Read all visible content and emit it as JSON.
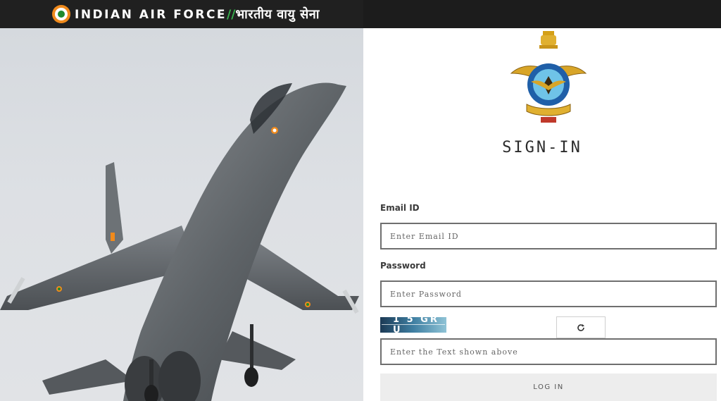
{
  "header": {
    "brand_english": "INDIAN AIR FORCE",
    "brand_separator": "//",
    "brand_hindi": "भारतीय वायु सेना",
    "colors": {
      "bar": "#1c1c1c",
      "separator": "#37b24d",
      "roundel_outer": "#f08a1c",
      "roundel_inner": "#1f8a2c"
    }
  },
  "hero": {
    "image": "fighter-jet-photo"
  },
  "signin": {
    "emblem": "iaf-crest-icon",
    "title": "SIGN-IN",
    "email": {
      "label": "Email ID",
      "placeholder": "Enter Email ID",
      "value": ""
    },
    "password": {
      "label": "Password",
      "placeholder": "Enter Password",
      "value": ""
    },
    "captcha": {
      "text": "1 5 GR U",
      "placeholder": "Enter the Text shown above",
      "value": "",
      "refresh_icon": "refresh-icon"
    },
    "login_label": "LOG IN"
  }
}
